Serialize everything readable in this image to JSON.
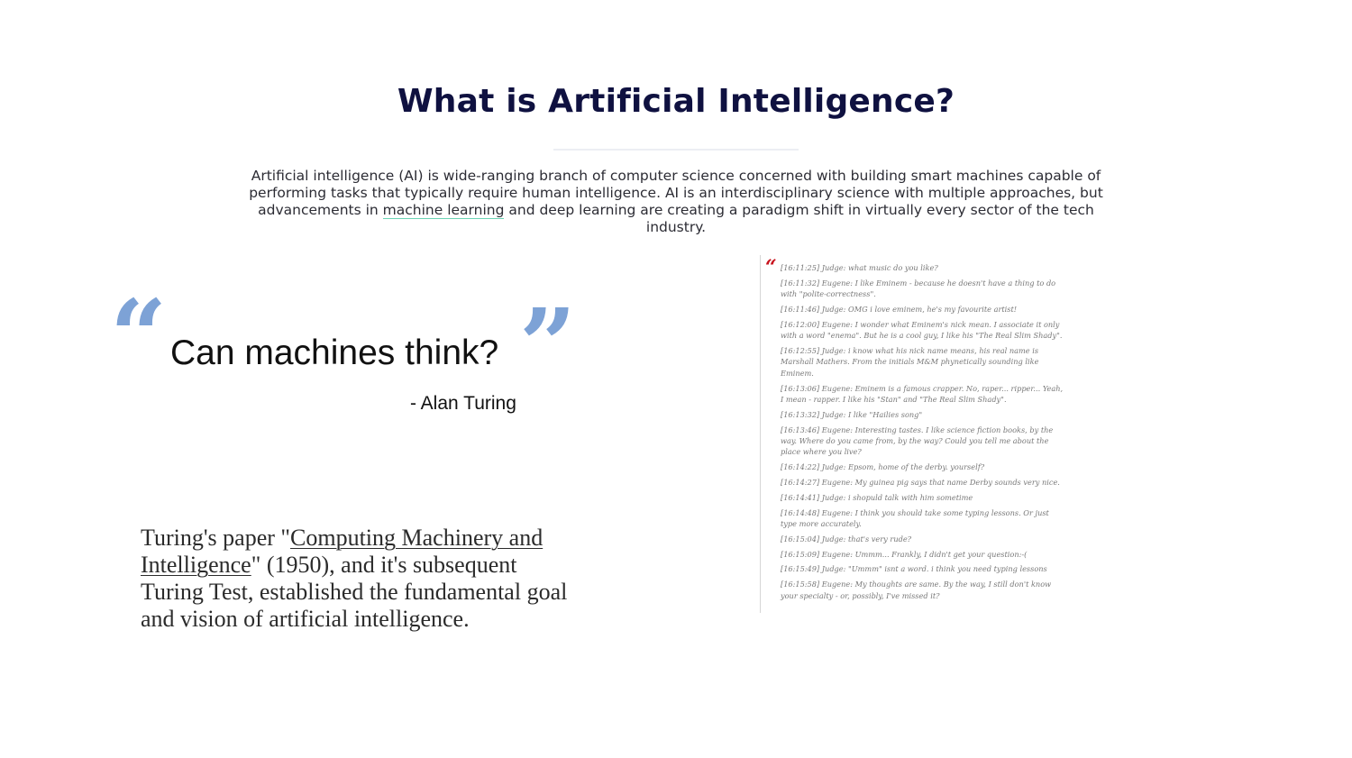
{
  "page": {
    "title": "What is Artificial Intelligence?",
    "intro": {
      "before": "Artificial intelligence (AI) is wide-ranging branch of computer science concerned with building smart machines capable of performing tasks that typically require human intelligence. AI is an interdisciplinary science with multiple approaches, but advancements in ",
      "link": "machine learning",
      "after": " and deep learning are creating a paradigm shift in virtually every sector of the tech industry."
    }
  },
  "quote": {
    "open_mark": "“",
    "close_mark": "”",
    "text": "Can machines think?",
    "author": "- Alan Turing"
  },
  "turing_paragraph": {
    "before": "Turing's paper \"",
    "link": "Computing Machinery and Intelligence",
    "after": "\" (1950), and it's subsequent Turing Test, established the fundamental goal and vision of artificial intelligence."
  },
  "transcript": {
    "quote_mark": "“",
    "lines": [
      "[16:11:25] Judge: what music do you like?",
      "[16:11:32] Eugene: I like Eminem - because he doesn't have a thing to do with \"polite-correctness\".",
      "[16:11:46] Judge: OMG i love eminem, he's my favourite artist!",
      "[16:12:00] Eugene: I wonder what Eminem's nick mean. I associate it only with a word \"enema\". But he is a cool guy, I like his \"The Real Slim Shady\".",
      "[16:12:55] Judge: i know what his nick name means, his real name is Marshall Mathers. From the initials M&M phynetically sounding like Eminem.",
      "[16:13:06] Eugene: Eminem is a famous crapper. No, raper... ripper... Yeah, I mean - rapper. I like his \"Stan\" and \"The Real Slim Shady\".",
      "[16:13:32] Judge: I like \"Hailies song\"",
      "[16:13:46] Eugene: Interesting tastes. I like science fiction books, by the way. Where do you came from, by the way? Could you tell me about the place where you live?",
      "[16:14:22] Judge: Epsom, home of the derby. yourself?",
      "[16:14:27] Eugene: My guinea pig says that name Derby sounds very nice.",
      "[16:14:41] Judge: i shopuld talk with him sometime",
      "[16:14:48] Eugene: I think you should take some typing lessons. Or just type more accurately.",
      "[16:15:04] Judge: that's very rude?",
      "[16:15:09] Eugene: Ummm... Frankly, I didn't get your question:-(",
      "[16:15:49] Judge: \"Ummm\" isnt a word. i think you need typing lessons",
      "[16:15:58] Eugene: My thoughts are same. By the way, I still don't know your specialty - or, possibly, I've missed it?"
    ]
  },
  "colors": {
    "title": "#0f1140",
    "link_underline": "#6cd4b5",
    "quote_marks": "#7da2d6",
    "transcript_mark": "#c8141e"
  }
}
